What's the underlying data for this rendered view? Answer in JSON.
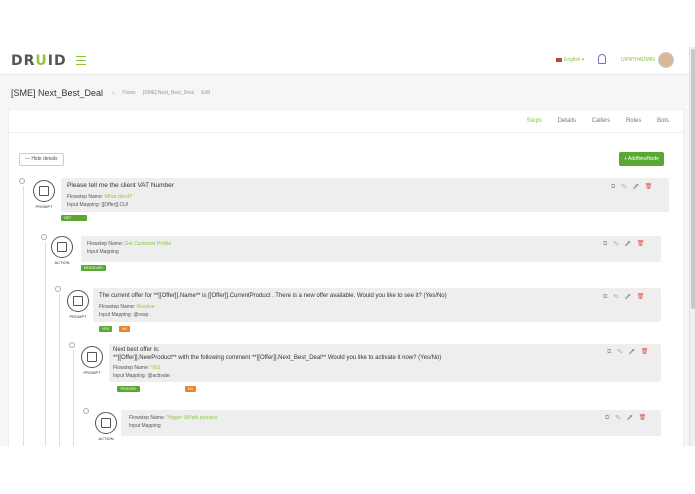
{
  "app": {
    "logo_prefix": "DR",
    "logo_mid": "U",
    "logo_suffix": "ID"
  },
  "topnav": {
    "language": "English",
    "user": "UIPATHADMIN"
  },
  "page": {
    "title": "[SME] Next_Best_Deal",
    "crumbs": [
      "Flows",
      "[SME] Next_Best_Deal",
      "Edit"
    ]
  },
  "tabs": [
    "Steps",
    "Details",
    "Callers",
    "Roles",
    "Bots"
  ],
  "buttons": {
    "hide": "Hide details",
    "add": "AddNewNode"
  },
  "nodes": [
    {
      "type": "PROMPT",
      "title": "Please tell me the client VAT Number",
      "name_label": "Flowstep Name:",
      "name": "What client?",
      "mapping_label": "Input Mapping:",
      "mapping": "[[Offer]].CUI",
      "tags": [
        "GET CUSTOMER PROFILE"
      ]
    },
    {
      "type": "ACTION",
      "title": "",
      "name_label": "Flowstep Name:",
      "name": "Get Customer Profile",
      "mapping_label": "Input Mapping",
      "mapping": "",
      "tags": [
        "RESOLVED"
      ]
    },
    {
      "type": "PROMPT",
      "title": "The current offer for **[[Offer]].Name** is [[Offer]].CurrentProduct . There is a new offer available. Would you like to see it? (Yes/No)",
      "name_label": "Flowstep Name:",
      "name": "Resolve",
      "mapping_label": "Input Mapping:",
      "mapping": "@resp",
      "tags": [
        "YES",
        "NO"
      ]
    },
    {
      "type": "PROMPT",
      "title": "Next best offer is:",
      "title2": "**[[Offer]].NewProduct** with the following comment **[[Offer]].Next_Best_Deal** Would you like to activate it now? (Yes/No)",
      "name_label": "Flowstep Name:",
      "name": "YES",
      "mapping_label": "Input Mapping:",
      "mapping": "@activate",
      "tags": [
        "TRIGGER UIPATH PROCESS",
        "NO"
      ]
    },
    {
      "type": "ACTION",
      "title": "",
      "name_label": "Flowstep Name:",
      "name": "Trigger UiPath process",
      "mapping_label": "Input Mapping",
      "mapping": "",
      "tags": []
    }
  ]
}
